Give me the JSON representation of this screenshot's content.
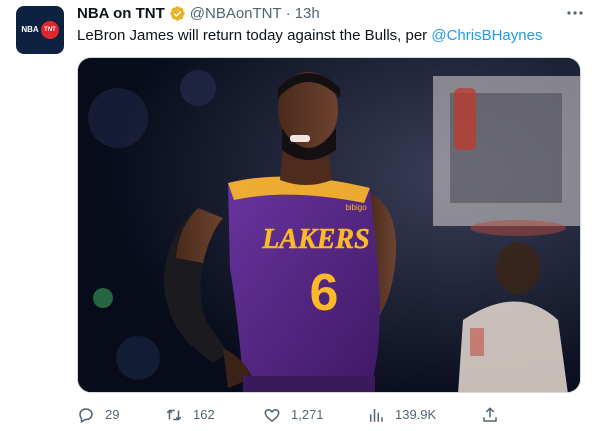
{
  "account": {
    "display_name": "NBA on TNT",
    "handle": "@NBAonTNT",
    "separator": "·",
    "time": "13h",
    "avatar_text_left": "NBA",
    "avatar_text_right": "TNT",
    "verified_color": "#e8b32a"
  },
  "tweet": {
    "text": "LeBron James will return today against the Bulls, per ",
    "mention": "@ChrisBHaynes",
    "image_alt": "LeBron James in a purple Lakers number 6 jersey"
  },
  "jersey": {
    "team": "LAKERS",
    "number": "6",
    "sponsor": "bibigo"
  },
  "actions": {
    "replies": "29",
    "retweets": "162",
    "likes": "1,271",
    "views": "139.9K"
  },
  "icons": {
    "more": "more-options-icon",
    "reply": "reply-icon",
    "retweet": "retweet-icon",
    "like": "heart-icon",
    "views": "views-icon",
    "share": "share-icon"
  },
  "colors": {
    "text_primary": "#0f1419",
    "text_secondary": "#536471",
    "link": "#1d9bf0",
    "lakers_purple": "#552583",
    "lakers_gold": "#fdb927"
  }
}
